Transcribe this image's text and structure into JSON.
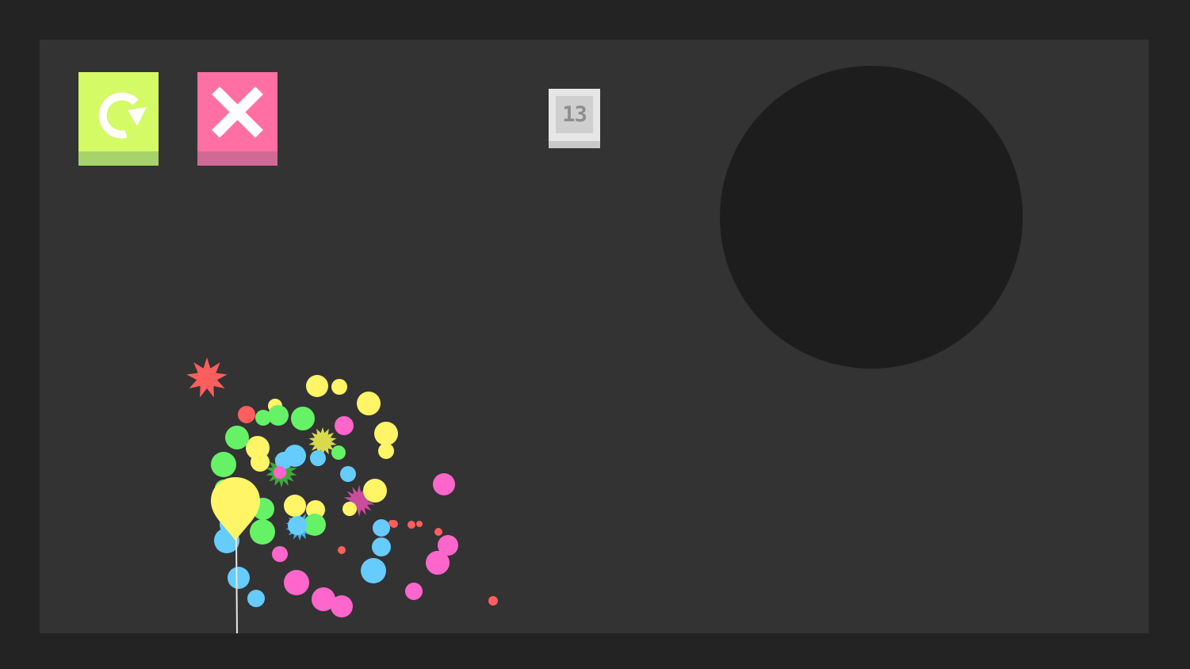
{
  "hud": {
    "restart_icon": "restart-arrow-icon",
    "close_icon": "close-x-icon",
    "level_number": "13"
  },
  "colors": {
    "restart_face": "#d4fa66",
    "restart_lip": "#a6d46a",
    "close_face": "#ff6fa2",
    "close_lip": "#d06a95",
    "balloon": "#fff566",
    "string": "#e6e6e6",
    "yellow": "#fff566",
    "green": "#66f266",
    "blue": "#66ccff",
    "pink": "#ff66cc",
    "red": "#ff5e5e"
  }
}
